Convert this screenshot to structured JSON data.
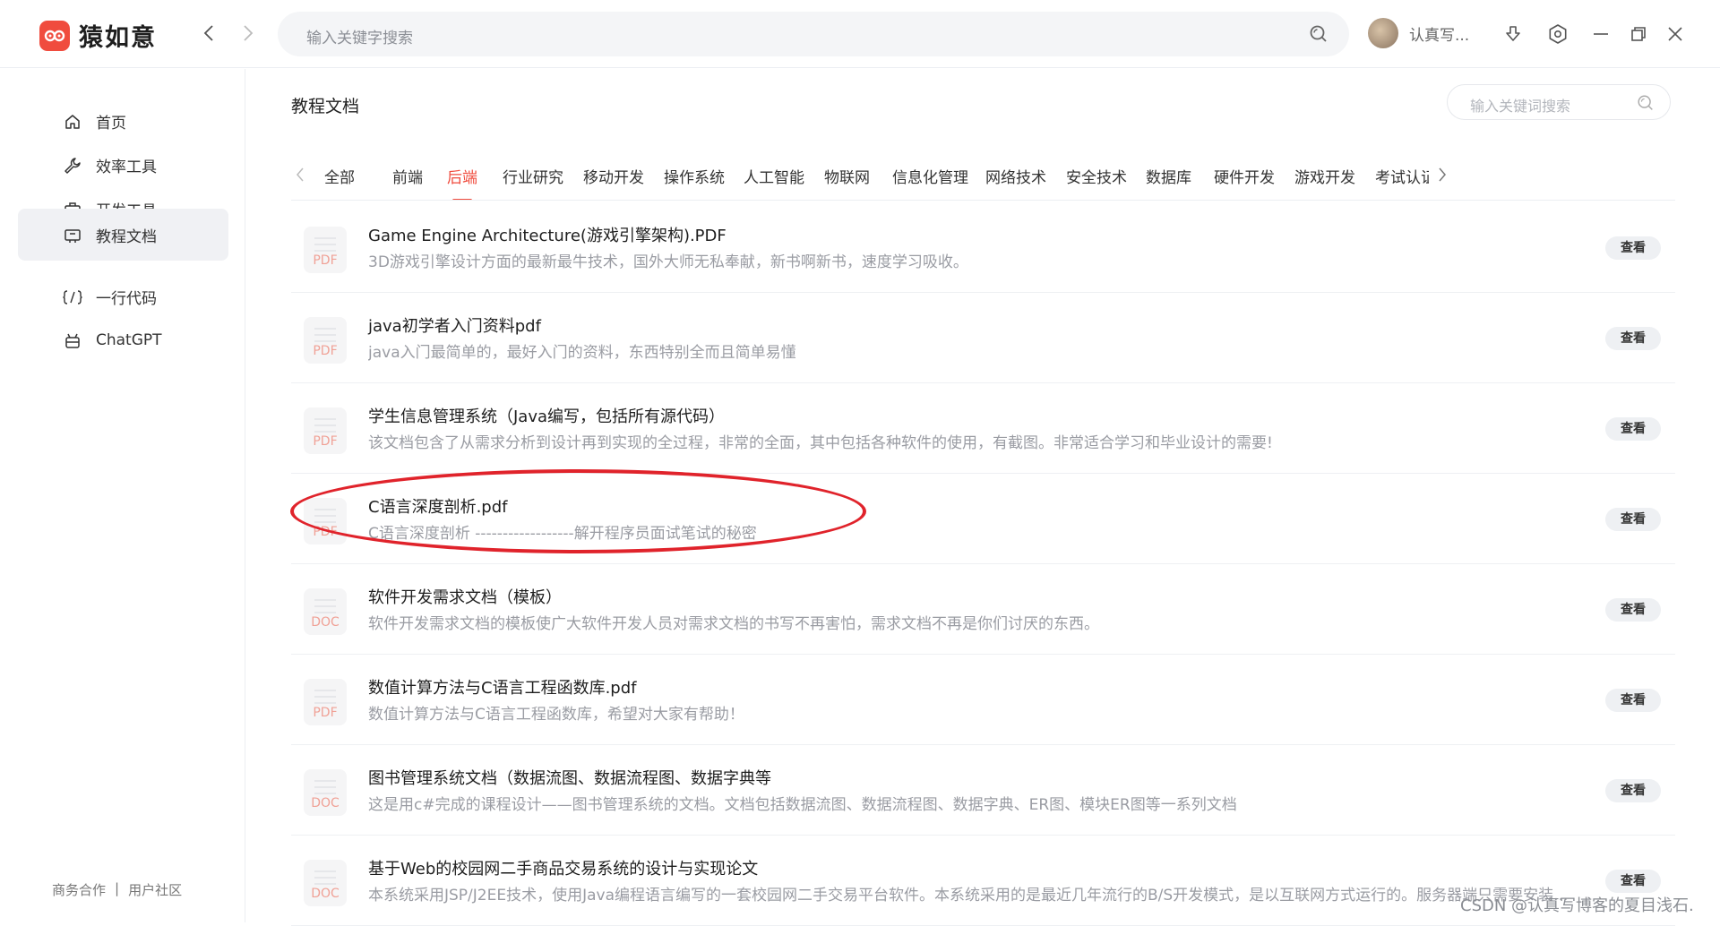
{
  "app": {
    "name": "猿如意",
    "brand_color": "#f04c3e"
  },
  "topbar": {
    "search_placeholder": "输入关键字搜索",
    "user_name": "认真写...",
    "icons": [
      "chevron-left-icon",
      "chevron-right-icon",
      "search-icon",
      "download-icon",
      "settings-icon",
      "minimize-icon",
      "restore-icon",
      "close-icon"
    ]
  },
  "sidebar": {
    "items": [
      {
        "label": "首页",
        "icon": "home-icon"
      },
      {
        "label": "效率工具",
        "icon": "wrench-icon"
      },
      {
        "label": "开发工具",
        "icon": "toolbox-icon"
      },
      {
        "label": "教程文档",
        "icon": "book-icon",
        "active": true
      },
      {
        "label": "一行代码",
        "icon": "code-icon"
      },
      {
        "label": "ChatGPT",
        "icon": "robot-icon"
      }
    ],
    "footer": {
      "business": "商务合作",
      "separator": "|",
      "community": "用户社区"
    }
  },
  "main": {
    "title": "教程文档",
    "search_placeholder": "输入关键词搜索",
    "tabs": [
      "全部",
      "前端",
      "后端",
      "行业研究",
      "移动开发",
      "操作系统",
      "人工智能",
      "物联网",
      "信息化管理",
      "网络技术",
      "安全技术",
      "数据库",
      "硬件开发",
      "游戏开发",
      "考试认证"
    ],
    "active_tab": "后端",
    "view_label": "查看",
    "documents": [
      {
        "type": "PDF",
        "title": "Game Engine Architecture(游戏引擎架构).PDF",
        "desc": "3D游戏引擎设计方面的最新最牛技术，国外大师无私奉献，新书啊新书，速度学习吸收。"
      },
      {
        "type": "PDF",
        "title": "java初学者入门资料pdf",
        "desc": "java入门最简单的，最好入门的资料，东西特别全而且简单易懂"
      },
      {
        "type": "PDF",
        "title": "学生信息管理系统（Java编写，包括所有源代码）",
        "desc": "该文档包含了从需求分析到设计再到实现的全过程，非常的全面，其中包括各种软件的使用，有截图。非常适合学习和毕业设计的需要!"
      },
      {
        "type": "PDF",
        "title": "C语言深度剖析.pdf",
        "desc": "C语言深度剖析 ------------------解开程序员面试笔试的秘密",
        "highlighted": true
      },
      {
        "type": "DOC",
        "title": "软件开发需求文档（模板）",
        "desc": "软件开发需求文档的模板使广大软件开发人员对需求文档的书写不再害怕，需求文档不再是你们讨厌的东西。"
      },
      {
        "type": "PDF",
        "title": "数值计算方法与C语言工程函数库.pdf",
        "desc": "数值计算方法与C语言工程函数库，希望对大家有帮助！"
      },
      {
        "type": "DOC",
        "title": "图书管理系统文档（数据流图、数据流程图、数据字典等",
        "desc": "这是用c#完成的课程设计——图书管理系统的文档。文档包括数据流图、数据流程图、数据字典、ER图、模块ER图等一系列文档"
      },
      {
        "type": "DOC",
        "title": "基于Web的校园网二手商品交易系统的设计与实现论文",
        "desc": "本系统采用JSP/J2EE技术，使用Java编程语言编写的一套校园网二手交易平台软件。本系统采用的是最近几年流行的B/S开发模式，是以互联网方式运行的。服务器端只需要安装..."
      }
    ]
  },
  "watermark": "CSDN @认真写博客的夏目浅石."
}
